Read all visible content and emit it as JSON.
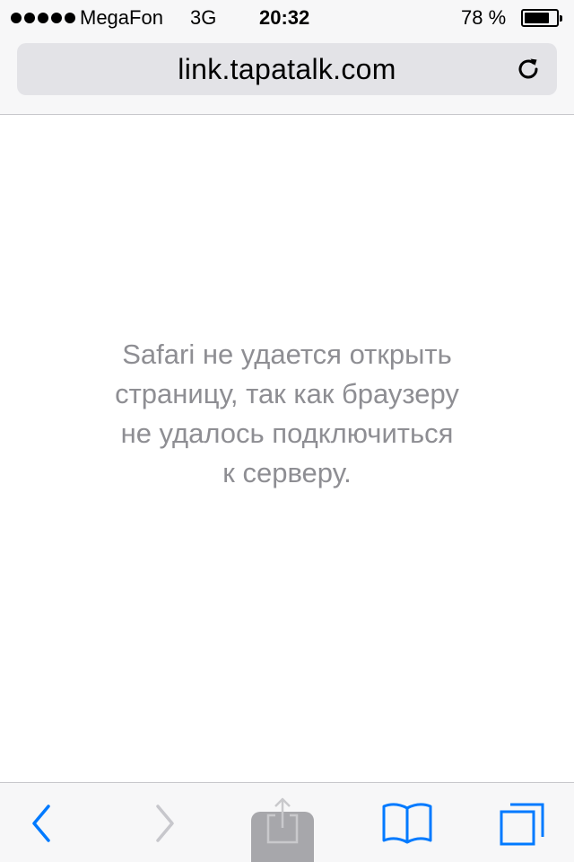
{
  "status_bar": {
    "carrier": "MegaFon",
    "network": "3G",
    "time": "20:32",
    "battery_percent": "78 %",
    "battery_level": 0.78,
    "signal_bars": 5
  },
  "address_bar": {
    "url": "link.tapatalk.com",
    "reload_icon": "reload-icon"
  },
  "content": {
    "error_lines": [
      "Safari не удается открыть",
      "страницу, так как браузеру",
      "не удалось подключиться",
      "к серверу."
    ]
  },
  "toolbar": {
    "back_icon": "chevron-left-icon",
    "forward_icon": "chevron-right-icon",
    "share_icon": "share-icon",
    "bookmarks_icon": "book-icon",
    "tabs_icon": "tabs-icon"
  },
  "colors": {
    "accent": "#007aff",
    "disabled": "#c7c7cc",
    "message_text": "#8e8e93",
    "bar_background": "#f7f7f8",
    "url_field": "#e3e3e7"
  }
}
